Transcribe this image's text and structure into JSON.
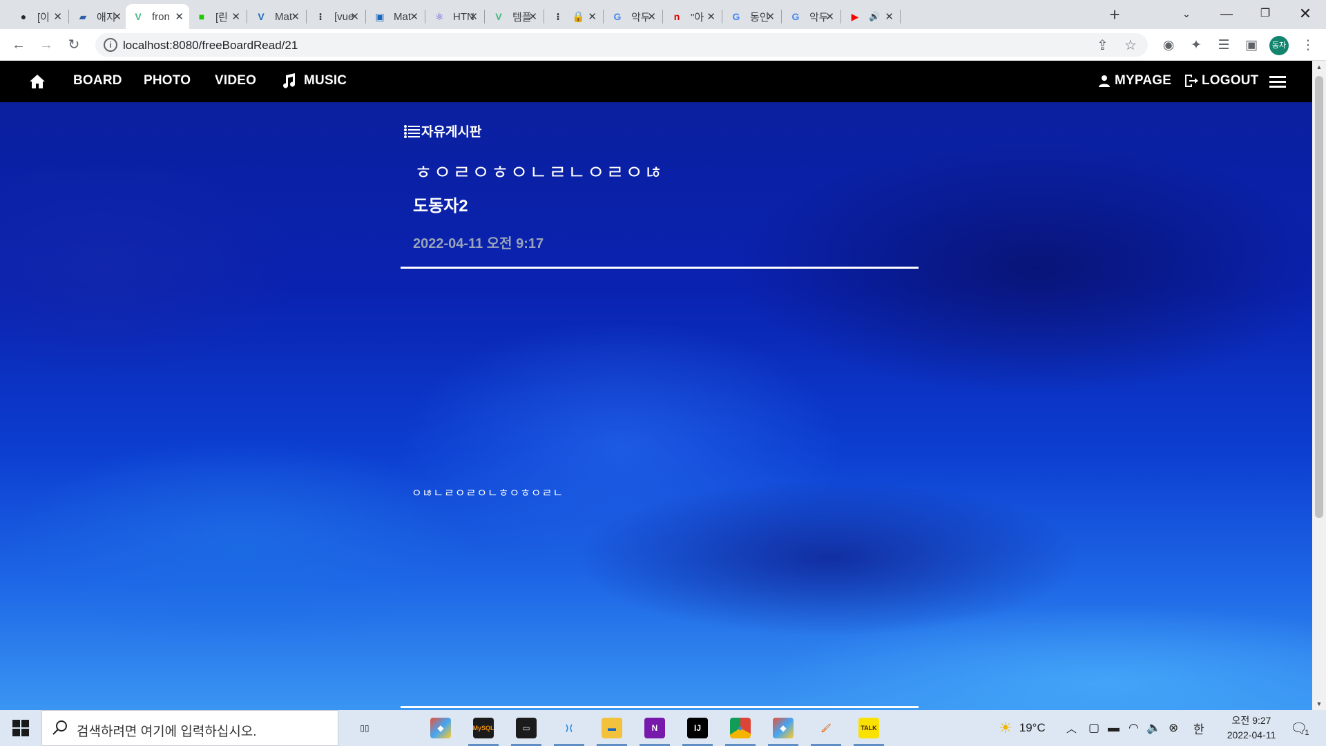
{
  "browser": {
    "tabs": [
      {
        "icon": "github-icon",
        "title": "[이"
      },
      {
        "icon": "car-icon",
        "title": "애지"
      },
      {
        "icon": "vue-icon",
        "title": "fron",
        "active": true
      },
      {
        "icon": "green-icon",
        "title": "[린"
      },
      {
        "icon": "vuetify-icon",
        "title": "Mat"
      },
      {
        "icon": "dots-icon",
        "title": "[vue"
      },
      {
        "icon": "square-icon",
        "title": "Mat"
      },
      {
        "icon": "atom-icon",
        "title": "HTN"
      },
      {
        "icon": "vue-icon",
        "title": "템플"
      },
      {
        "icon": "dots-icon",
        "title": "🔒"
      },
      {
        "icon": "google-icon",
        "title": "악두"
      },
      {
        "icon": "n-icon",
        "title": "\"아"
      },
      {
        "icon": "google-icon",
        "title": "동인"
      },
      {
        "icon": "google-icon",
        "title": "악두"
      },
      {
        "icon": "youtube-icon",
        "title": ""
      }
    ],
    "url": "localhost:8080/freeBoardRead/21",
    "profile_label": "동자"
  },
  "site": {
    "nav": {
      "board": "BOARD",
      "photo": "PHOTO",
      "video": "VIDEO",
      "music": "MUSIC",
      "mypage": "MYPAGE",
      "logout": "LOGOUT"
    },
    "board_name": "자유게시판",
    "post": {
      "title": "ㅎㅇㄹㅇㅎㅇㄴㄹㄴㅇㄹㅇㄶ",
      "author": "도동자2",
      "date": "2022-04-11 오전 9:17",
      "body": "ㅇㄶㄴㄹㅇㄹㅇㄴㅎㅇㅎㅇㄹㄴ"
    }
  },
  "taskbar": {
    "search_placeholder": "검색하려면 여기에 입력하십시오.",
    "apps": [
      {
        "name": "task-view-icon"
      },
      {
        "name": "git-icon"
      },
      {
        "name": "mysql-icon",
        "label": "MySQL"
      },
      {
        "name": "terminal-icon"
      },
      {
        "name": "vscode-icon"
      },
      {
        "name": "file-explorer-icon"
      },
      {
        "name": "onenote-icon",
        "label": "N"
      },
      {
        "name": "intellij-icon",
        "label": "IJ"
      },
      {
        "name": "chrome-icon"
      },
      {
        "name": "git-icon"
      },
      {
        "name": "paint-icon"
      },
      {
        "name": "kakaotalk-icon",
        "label": "TALK"
      }
    ],
    "weather": "19°C",
    "ime": "한",
    "clock_time": "오전 9:27",
    "clock_date": "2022-04-11",
    "notification_count": "1"
  },
  "colors": {
    "nav_bg": "#000000",
    "date_text": "#9aa4b8",
    "page_bg": "#0a22b0"
  }
}
